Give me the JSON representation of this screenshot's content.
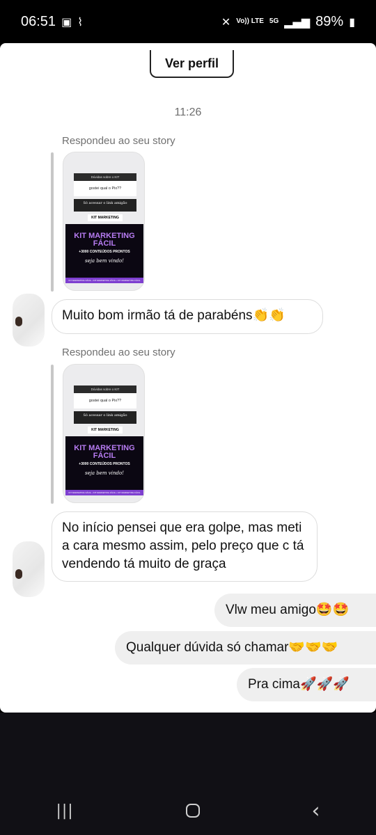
{
  "status": {
    "time": "06:51",
    "network": "Vo)) LTE",
    "gen": "5G",
    "battery": "89%"
  },
  "header": {
    "profile_button": "Ver perfil"
  },
  "timestamp": "11:26",
  "story_replies": [
    {
      "label": "Respondeu ao seu story",
      "story": {
        "top_text": "Dúvidas sobre o KIT",
        "question": "gostei qual o Pix??",
        "link_text": "Só acessar o link amigão",
        "kit_tag": "KIT MARKETING",
        "title": "KIT MARKETING FÁCIL",
        "subtitle": "+3000 CONTEÚDOS PRONTOS",
        "script": "seja bem vindo!",
        "strip": "KIT MARKETING FÁCIL • KIT MARKETING FÁCIL • KIT MARKETING FÁCIL"
      }
    },
    {
      "label": "Respondeu ao seu story",
      "story": {
        "top_text": "Dúvidas sobre o KIT",
        "question": "gostei qual o Pix??",
        "link_text": "Só acessar o link amigão",
        "kit_tag": "KIT MARKETING",
        "title": "KIT MARKETING FÁCIL",
        "subtitle": "+3000 CONTEÚDOS PRONTOS",
        "script": "seja bem vindo!",
        "strip": "KIT MARKETING FÁCIL • KIT MARKETING FÁCIL • KIT MARKETING FÁCIL"
      }
    }
  ],
  "incoming_messages": [
    {
      "text": "Muito bom irmão tá de parabéns👏👏"
    },
    {
      "text": "No início pensei que era golpe, mas meti a cara mesmo assim, pelo preço que c tá vendendo tá muito de graça"
    }
  ],
  "outgoing_messages": [
    {
      "text": "Vlw meu amigo🤩🤩"
    },
    {
      "text": "Qualquer dúvida só chamar🤝🤝🤝"
    },
    {
      "text": "Pra cima🚀🚀🚀"
    }
  ],
  "icons": [
    "gallery-icon",
    "signal-icon",
    "mute-icon",
    "battery-icon",
    "recent-apps-icon",
    "home-icon",
    "back-icon"
  ]
}
